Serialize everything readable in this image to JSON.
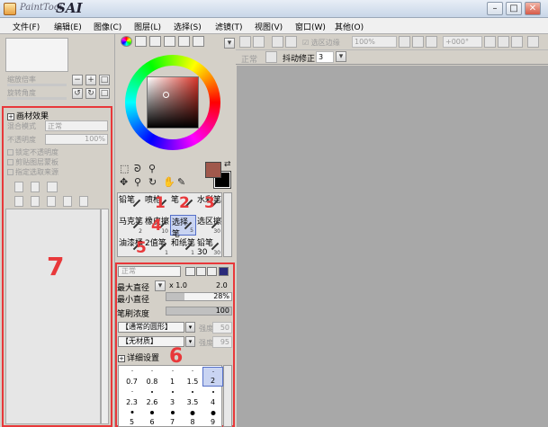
{
  "app": {
    "logo_small": "PaintTool",
    "logo_big": "SAI"
  },
  "window_controls": [
    "–",
    "□",
    "✕"
  ],
  "menu": [
    {
      "label": "文件(F)"
    },
    {
      "label": "编辑(E)"
    },
    {
      "label": "图像(C)"
    },
    {
      "label": "图层(L)"
    },
    {
      "label": "选择(S)"
    },
    {
      "label": "滤镜(T)"
    },
    {
      "label": "视图(V)"
    },
    {
      "label": "窗口(W)"
    },
    {
      "label": "其他(O)"
    }
  ],
  "navigator": {
    "zoom_label": "缩放倍率",
    "angle_label": "旋转角度"
  },
  "layer_panel": {
    "annotation": "7",
    "texture_label": "画材效果",
    "blend_label": "混合模式",
    "blend_value": "正常",
    "opacity_label": "不透明度",
    "opacity_value": "100%",
    "checkboxes": [
      "锁定不透明度",
      "剪贴图层蒙板",
      "指定选取来源"
    ]
  },
  "color": {
    "foreground": "#a0584c",
    "background": "#000000"
  },
  "brushes": {
    "annotations": [
      "1",
      "2",
      "3",
      "4",
      "5"
    ],
    "cells": [
      {
        "label": "铅笔",
        "size": ""
      },
      {
        "label": "喷枪",
        "size": ""
      },
      {
        "label": "笔",
        "size": ""
      },
      {
        "label": "水彩笔",
        "size": ""
      },
      {
        "label": "马克笔",
        "size": "2"
      },
      {
        "label": "橡皮擦",
        "size": "10"
      },
      {
        "label": "选择笔",
        "size": "5"
      },
      {
        "label": "选区擦",
        "size": "30"
      },
      {
        "label": "油漆桶",
        "size": ""
      },
      {
        "label": "2值笔",
        "size": "1"
      },
      {
        "label": "和纸笔",
        "size": "1"
      },
      {
        "label": "铅笔30",
        "size": "30"
      }
    ],
    "selected_index": 6
  },
  "brush_props": {
    "annotation": "6",
    "mode": "正常",
    "max_size_label": "最大直径",
    "max_size_mult": "x 1.0",
    "max_size_value": "2.0",
    "min_size_label": "最小直径",
    "min_size_value": "28%",
    "min_size_fraction": 0.28,
    "density_label": "笔刷浓度",
    "density_value": "100",
    "density_fraction": 1.0,
    "shape_dd": "【通常的圆形】",
    "shape_strength_label": "强度",
    "shape_strength_value": "50",
    "texture_dd": "【无材质】",
    "texture_strength_label": "强度",
    "texture_strength_value": "95",
    "detail_label": "详细设置",
    "sizes": [
      "0.7",
      "0.8",
      "1",
      "1.5",
      "2",
      "2.3",
      "2.6",
      "3",
      "3.5",
      "4",
      "5",
      "6",
      "7",
      "8",
      "9"
    ],
    "selected_size_index": 4
  },
  "top_toolbar": {
    "show_selection_label": "选区边缘",
    "zoom_value": "100%",
    "angle_value": "+000°",
    "mode_value": "正常",
    "stabilizer_label": "抖动修正",
    "stabilizer_value": "3"
  }
}
